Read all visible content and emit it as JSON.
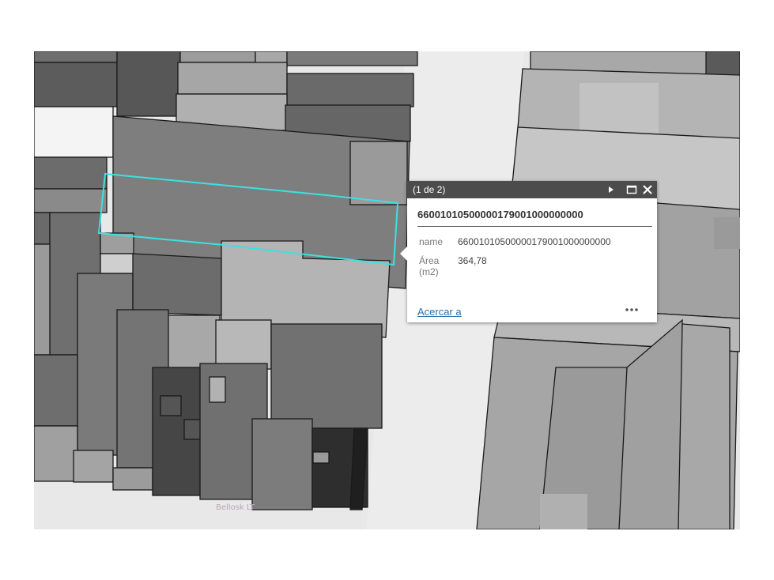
{
  "map": {
    "place_label": "Bellosk LT"
  },
  "popup": {
    "count": "(1 de 2)",
    "title": "66001010500000179001000000000",
    "fields": [
      {
        "label": "name",
        "value": "66001010500000179001000000000"
      },
      {
        "label": "Área (m2)",
        "value": "364,78"
      }
    ],
    "zoom_link": "Acercar a",
    "icons": {
      "next": "next-icon",
      "maximize": "maximize-icon",
      "close": "close-icon",
      "more": "more-icon"
    }
  },
  "colors": {
    "selection": "#3de0e0",
    "popup_header": "#4c4c4c",
    "link": "#2a6faa"
  }
}
